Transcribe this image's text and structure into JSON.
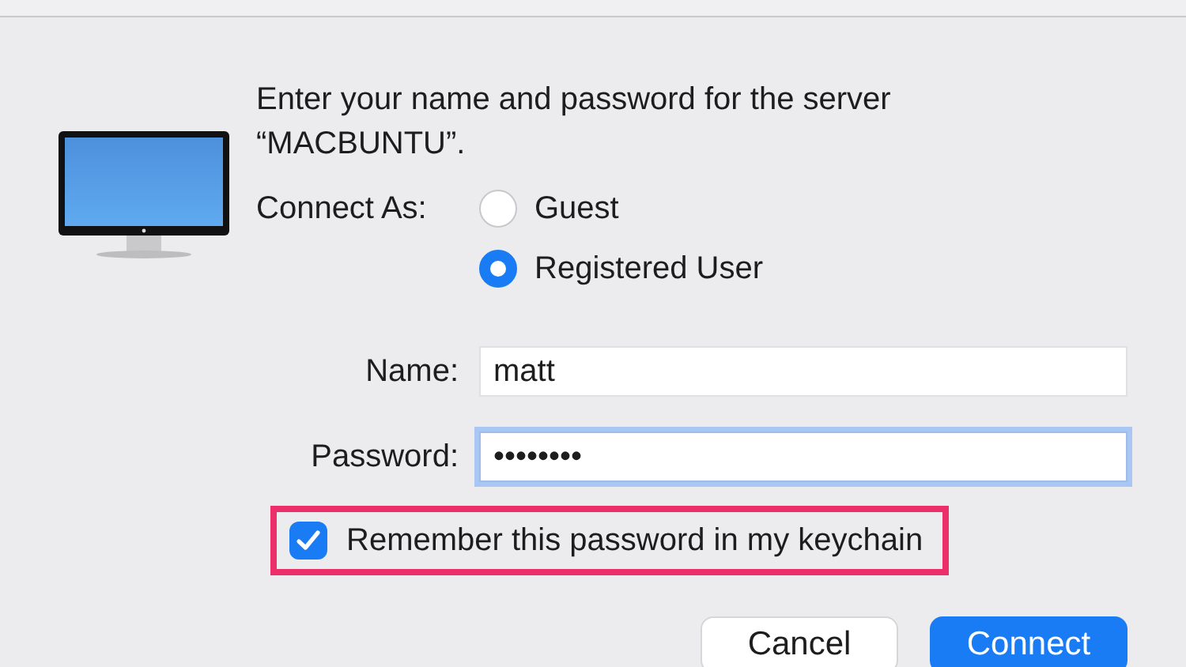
{
  "prompt": "Enter your name and password for the server “MACBUNTU”.",
  "connect_as": {
    "label": "Connect As:",
    "options": [
      {
        "label": "Guest",
        "selected": false
      },
      {
        "label": "Registered User",
        "selected": true
      }
    ]
  },
  "fields": [
    {
      "label": "Name:",
      "value": "matt",
      "focused": false
    },
    {
      "label": "Password:",
      "value": "••••••••",
      "focused": true
    }
  ],
  "remember": {
    "label": "Remember this password in my keychain",
    "checked": true,
    "highlighted": true
  },
  "buttons": [
    {
      "label": "Cancel",
      "kind": "default"
    },
    {
      "label": "Connect",
      "kind": "primary"
    }
  ]
}
